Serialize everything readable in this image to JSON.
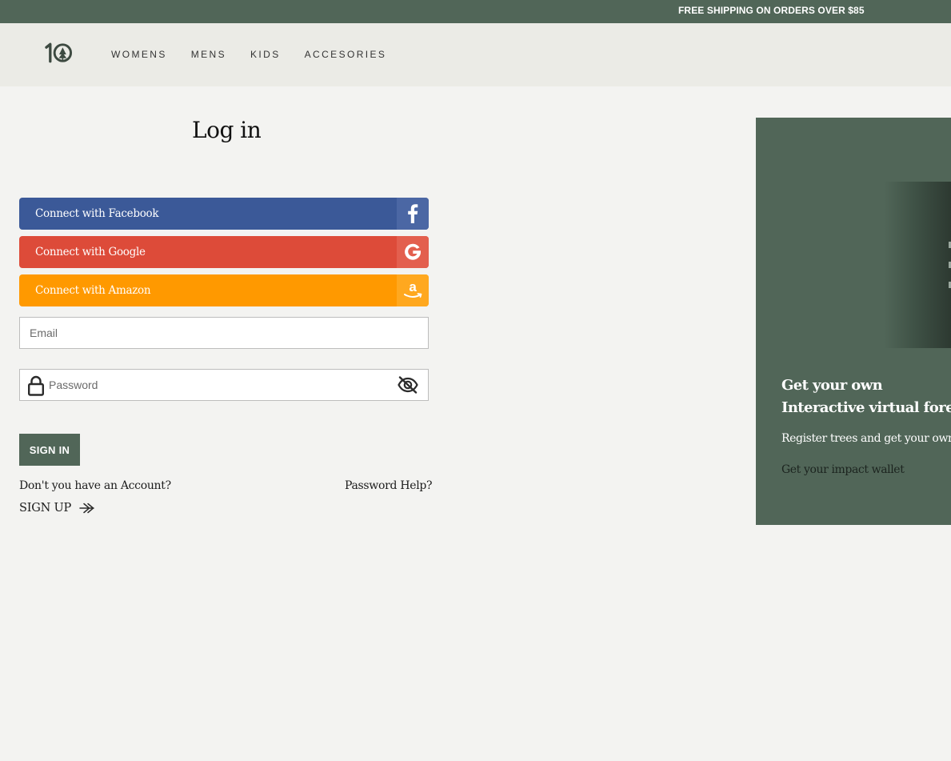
{
  "announcement": {
    "text": "FREE SHIPPING ON ORDERS OVER $85"
  },
  "header": {
    "logo_text": "10",
    "nav": [
      {
        "label": "WOMENS"
      },
      {
        "label": "MENS"
      },
      {
        "label": "KIDS"
      },
      {
        "label": "ACCESORIES"
      }
    ]
  },
  "login": {
    "title": "Log in",
    "social": {
      "facebook": {
        "label": "Connect with Facebook",
        "icon": "facebook-icon",
        "color": "#3b5998"
      },
      "google": {
        "label": "Connect with Google",
        "icon": "google-icon",
        "color": "#dd4b39"
      },
      "amazon": {
        "label": "Connect with Amazon",
        "icon": "amazon-icon",
        "color": "#ff9900"
      }
    },
    "email": {
      "placeholder": "Email",
      "value": ""
    },
    "password": {
      "placeholder": "Password",
      "value": ""
    },
    "signin_label": "SIGN IN",
    "no_account_text": "Don't you have an Account?",
    "password_help": "Password Help?",
    "signup_label": "SIGN UP"
  },
  "promo": {
    "heading_line1": "Get your own",
    "heading_line2": "Interactive virtual forest",
    "subtext": "Register trees and get your own",
    "link": "Get your impact wallet"
  },
  "colors": {
    "brand_green": "#516658",
    "background": "#f3f3f1",
    "header_bg": "#ebebe6"
  }
}
